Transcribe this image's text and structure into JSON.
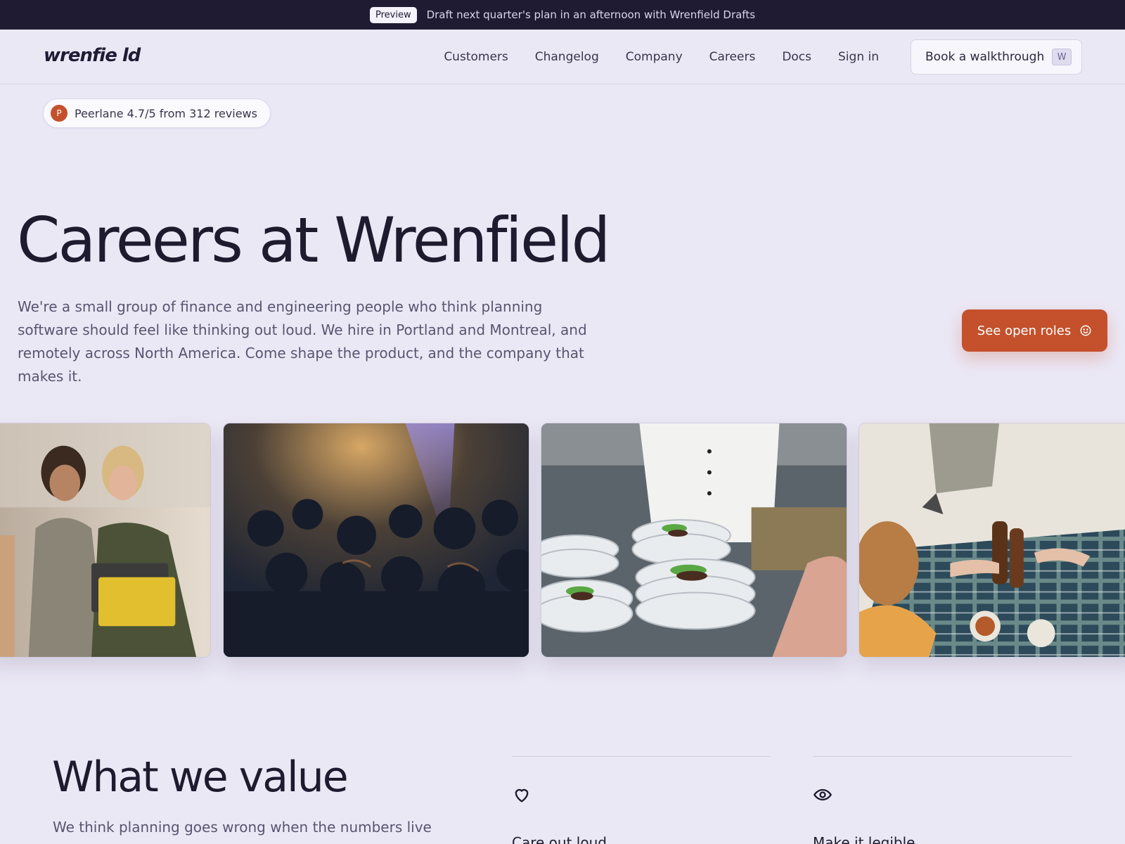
{
  "announcement": {
    "badge": "Preview",
    "message": "Draft next quarter's plan in an afternoon with Wrenfield Drafts"
  },
  "brand": {
    "logo": "wrenfie ld"
  },
  "nav": {
    "links": [
      "Customers",
      "Changelog",
      "Company",
      "Careers",
      "Docs",
      "Sign in"
    ],
    "cta": "Book a walkthrough",
    "cta_shortcut": "W"
  },
  "rating": {
    "avatar_letter": "P",
    "text": "Peerlane 4.7/5 from 312 reviews"
  },
  "hero": {
    "title": "Careers at Wrenfield",
    "description": "We're a small group of finance and engineering people who think planning software should feel like thinking out loud. We hire in Portland and Montreal, and remotely across North America. Come shape the product, and the company that makes it.",
    "cta": "See open roles",
    "cta_icon": "smile-icon"
  },
  "values": {
    "title": "What we value",
    "description": "We think planning goes wrong when the numbers live",
    "cards": [
      {
        "icon": "heart-icon",
        "title": "Care out loud"
      },
      {
        "icon": "eye-icon",
        "title": "Make it legible"
      }
    ]
  },
  "colors": {
    "background": "#ebe8f6",
    "topbar": "#1e1b33",
    "accent": "#c4512c"
  }
}
